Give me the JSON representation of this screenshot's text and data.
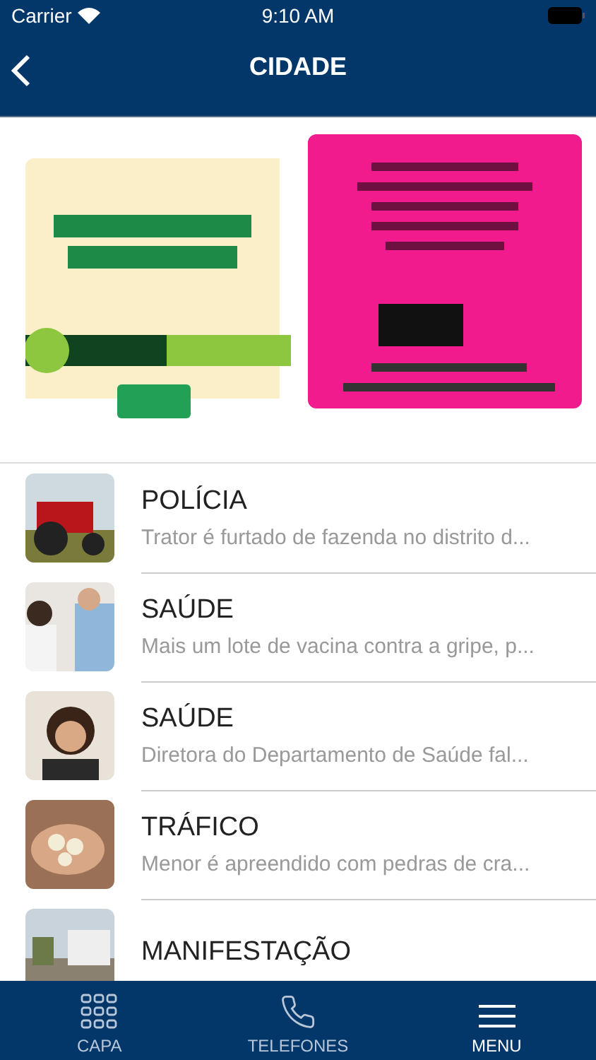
{
  "status_bar": {
    "carrier": "Carrier",
    "time": "9:10 AM"
  },
  "nav": {
    "title": "CIDADE"
  },
  "news": [
    {
      "category": "POLÍCIA",
      "summary": "Trator é furtado de fazenda no distrito d..."
    },
    {
      "category": "SAÚDE",
      "summary": "Mais um lote de vacina contra a gripe, p..."
    },
    {
      "category": "SAÚDE",
      "summary": "Diretora do Departamento de Saúde fal..."
    },
    {
      "category": "TRÁFICO",
      "summary": "Menor é apreendido com pedras de cra..."
    },
    {
      "category": "MANIFESTAÇÃO"
    }
  ],
  "tabs": [
    {
      "label": "CAPA",
      "selected": false
    },
    {
      "label": "TELEFONES",
      "selected": false
    },
    {
      "label": "MENU",
      "selected": true
    }
  ]
}
